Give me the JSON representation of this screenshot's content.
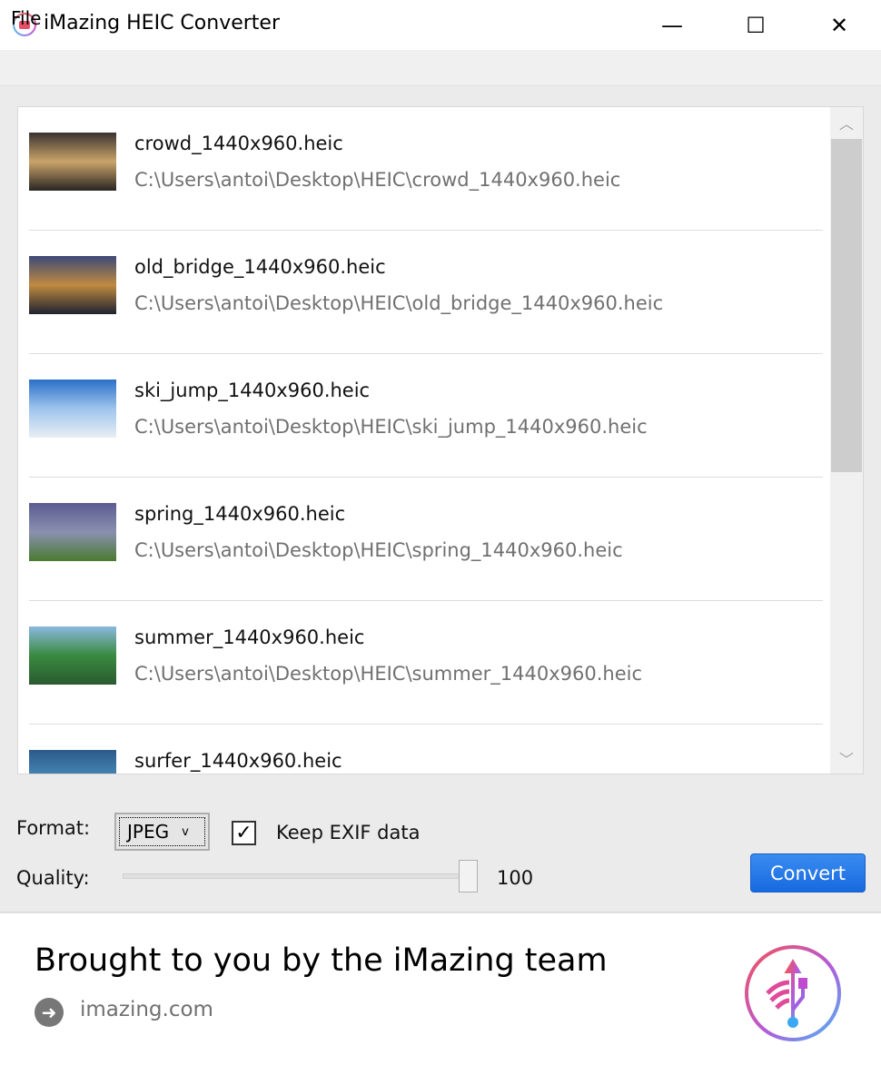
{
  "window": {
    "title": "iMazing HEIC Converter",
    "minimize": "—",
    "maximize": "☐",
    "close": "✕"
  },
  "menu": {
    "file": "File"
  },
  "files": [
    {
      "name": "crowd_1440x960.heic",
      "path": "C:\\Users\\antoi\\Desktop\\HEIC\\crowd_1440x960.heic",
      "thumb": [
        "#3a3330",
        "#c9a46a",
        "#2a2522"
      ]
    },
    {
      "name": "old_bridge_1440x960.heic",
      "path": "C:\\Users\\antoi\\Desktop\\HEIC\\old_bridge_1440x960.heic",
      "thumb": [
        "#3c4a78",
        "#c08a40",
        "#1e2230"
      ]
    },
    {
      "name": "ski_jump_1440x960.heic",
      "path": "C:\\Users\\antoi\\Desktop\\HEIC\\ski_jump_1440x960.heic",
      "thumb": [
        "#2a6fc8",
        "#9ec4ec",
        "#e8eef4"
      ]
    },
    {
      "name": "spring_1440x960.heic",
      "path": "C:\\Users\\antoi\\Desktop\\HEIC\\spring_1440x960.heic",
      "thumb": [
        "#5a5c90",
        "#8a90b0",
        "#4a7a30"
      ]
    },
    {
      "name": "summer_1440x960.heic",
      "path": "C:\\Users\\antoi\\Desktop\\HEIC\\summer_1440x960.heic",
      "thumb": [
        "#8ab8e0",
        "#3a8a40",
        "#2a5a30"
      ]
    },
    {
      "name": "surfer_1440x960.heic",
      "path": "",
      "thumb": [
        "#2a5a8a",
        "#4a8ab8",
        "#1a3a5a"
      ]
    }
  ],
  "controls": {
    "format_label": "Format:",
    "format_value": "JPEG",
    "keep_exif_label": "Keep EXIF data",
    "keep_exif_checked": true,
    "quality_label": "Quality:",
    "quality_value": "100",
    "convert_label": "Convert"
  },
  "footer": {
    "promo": "Brought to you by the iMazing team",
    "link": "imazing.com"
  },
  "colors": {
    "accent": "#1a6fe6"
  }
}
